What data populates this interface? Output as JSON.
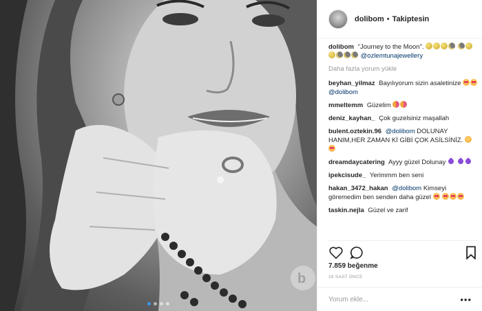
{
  "post": {
    "username": "dolibom",
    "separator": "•",
    "follow_status": "Takiptesin",
    "caption_user": "dolibom",
    "caption_text": "\"Journey to the Moon\".",
    "caption_mention": "@ozlemtunajewellery",
    "load_more": "Daha fazla yorum yükle",
    "likes": "7.859 beğenme",
    "time": "16 SAAT ÖNCE",
    "comment_placeholder": "Yorum ekle...",
    "more_label": "•••"
  },
  "comments": [
    {
      "user": "beyhan_yilmaz",
      "text": "Bayılıyorum sizin asaletinize",
      "mention": "@dolibom"
    },
    {
      "user": "mmeltemm",
      "text": "Güzelim"
    },
    {
      "user": "deniz_kayhan_",
      "text": "Çok guzelsiniz maşallah"
    },
    {
      "user": "bulent.oztekin.96",
      "mention": "@dolibom",
      "text": "DOLUNAY HANIM,HER ZAMAN Kİ GİBİ ÇOK ASİLSİNİZ."
    },
    {
      "user": "dreamdaycatering",
      "text": "Ayyy güzel Dolunay"
    },
    {
      "user": "ipekcisude_",
      "text": "Yerimmm ben seni"
    },
    {
      "user": "hakan_3472_hakan",
      "mention": "@dolibom",
      "text": "Kimseyi göremedim ben senden daha güzel"
    },
    {
      "user": "taskin.nejla",
      "text": "Güzel ve zarif"
    }
  ],
  "icons": {
    "like": "heart-icon",
    "comment": "comment-icon",
    "save": "bookmark-icon"
  },
  "colors": {
    "link": "#003569",
    "carousel_active": "#3897f0"
  }
}
